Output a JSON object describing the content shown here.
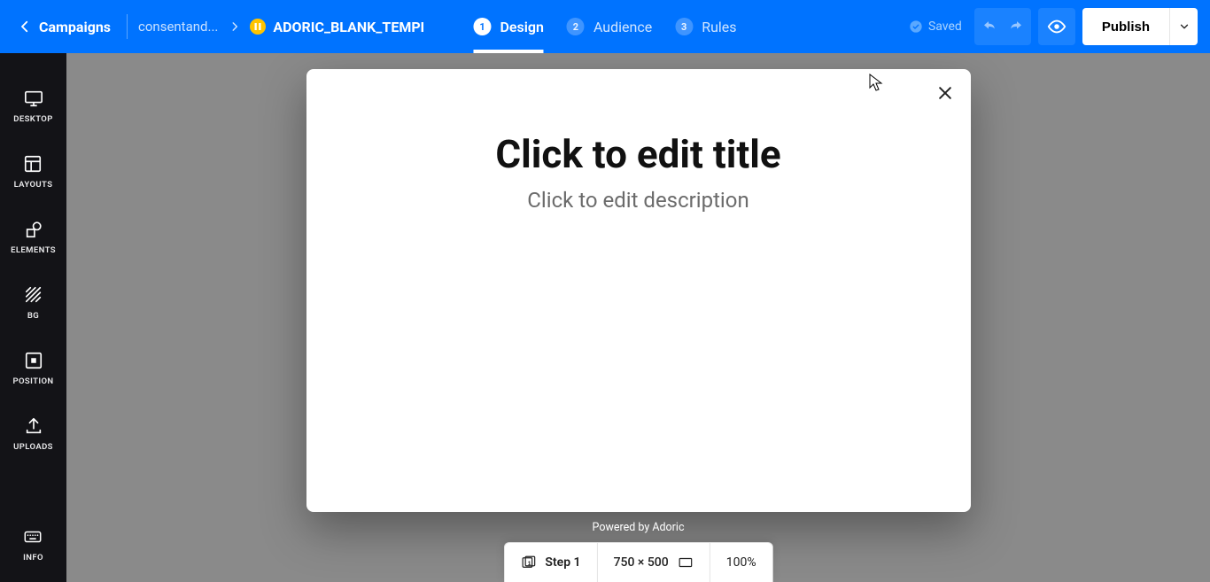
{
  "header": {
    "back_label": "Campaigns",
    "project_name": "consentand...",
    "template_name": "ADORIC_BLANK_TEMPL",
    "saved_label": "Saved",
    "publish_label": "Publish"
  },
  "steps": [
    {
      "num": "1",
      "label": "Design",
      "active": true
    },
    {
      "num": "2",
      "label": "Audience",
      "active": false
    },
    {
      "num": "3",
      "label": "Rules",
      "active": false
    }
  ],
  "sidebar": {
    "items": [
      {
        "label": "DESKTOP",
        "icon": "desktop"
      },
      {
        "label": "LAYOUTS",
        "icon": "layouts"
      },
      {
        "label": "ELEMENTS",
        "icon": "elements"
      },
      {
        "label": "BG",
        "icon": "bg"
      },
      {
        "label": "POSITION",
        "icon": "position"
      },
      {
        "label": "UPLOADS",
        "icon": "uploads"
      }
    ],
    "info_label": "INFO"
  },
  "canvas": {
    "title": "Click to edit title",
    "description": "Click to edit description",
    "powered_by": "Powered by Adoric"
  },
  "bottom": {
    "step_label": "Step 1",
    "dimensions": "750 × 500",
    "zoom": "100%"
  },
  "colors": {
    "accent": "#0073ff",
    "sidebar_bg": "#131317",
    "canvas_bg": "#8a8a8a"
  }
}
